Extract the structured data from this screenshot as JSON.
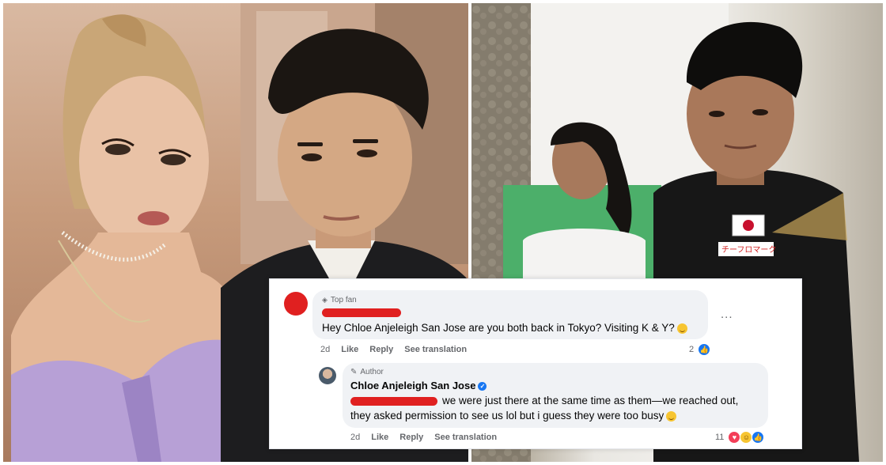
{
  "comment_thread": {
    "top_comment": {
      "badge": "Top fan",
      "text": "Hey Chloe Anjeleigh San Jose are you both back in Tokyo? Visiting K & Y?",
      "time": "2d",
      "like_label": "Like",
      "reply_label": "Reply",
      "translation_label": "See translation",
      "reaction_count": "2",
      "menu": "..."
    },
    "reply": {
      "badge": "Author",
      "author": "Chloe Anjeleigh San Jose",
      "text_line1": "we were just there at the same time as them—we reached out,",
      "text_line2": "they asked permission to see us lol but i guess they were too busy",
      "time": "2d",
      "like_label": "Like",
      "reply_label": "Reply",
      "translation_label": "See translation",
      "reaction_count": "11"
    }
  },
  "photos": {
    "right_shirt_text": "チーフロマーク"
  },
  "colors": {
    "redaction": "#e02020",
    "like_blue": "#1877f2",
    "love_red": "#f33e58",
    "haha_yellow": "#f7c531"
  }
}
